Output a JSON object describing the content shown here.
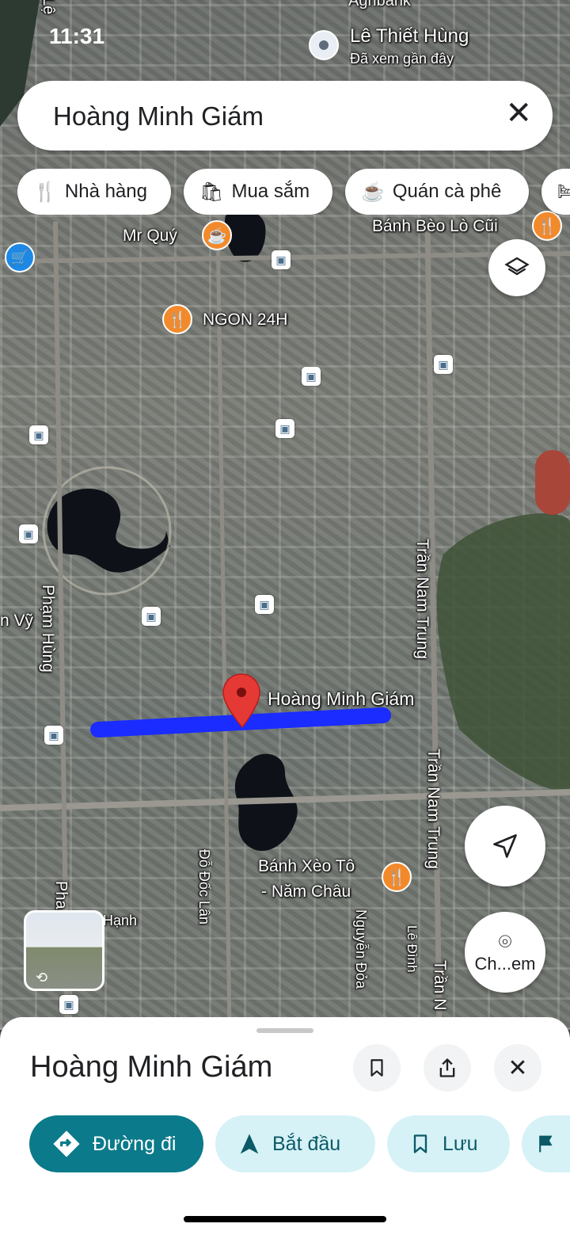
{
  "status_bar": {
    "time": "11:31"
  },
  "recent_place": {
    "name": "Lê Thiết Hùng",
    "subtitle": "Đã xem gần đây",
    "top_label": "Agribank"
  },
  "search": {
    "query": "Hoàng Minh Giám"
  },
  "chips": [
    {
      "label": "Nhà hàng",
      "icon": "fork-knife-icon"
    },
    {
      "label": "Mua sắm",
      "icon": "shopping-bag-icon"
    },
    {
      "label": "Quán cà phê",
      "icon": "coffee-cup-icon"
    }
  ],
  "map": {
    "pois": [
      {
        "name": "Mr Quý",
        "icon": "coffee-icon"
      },
      {
        "name": "Bánh Bèo Lò Cũi",
        "icon": "restaurant-icon"
      },
      {
        "name": "NGON 24H",
        "icon": "restaurant-icon"
      },
      {
        "name": "Bánh Xèo Tô - Năm Châu",
        "line1": "Bánh Xèo Tô",
        "line2": "- Năm Châu",
        "icon": "restaurant-icon"
      }
    ],
    "streets": {
      "pham_hung": "Phạm Hùng",
      "tran_nam_trung_1": "Trần Nam Trung",
      "tran_nam_trung_2": "Trần Nam Trung",
      "tran_n": "Trần N",
      "do_doc_lan": "Đỗ Đốc Lân",
      "nguyen_doa": "Nguyễn Đỏa",
      "le_dinh": "Lê Đình",
      "hanh": "Hạnh",
      "vy": "n Vỹ",
      "le_top": "Lệ",
      "ph": "Pha"
    },
    "selected_street": "Hoàng Minh Giám",
    "route_color": "#1a2cff",
    "pin_color": "#e53935"
  },
  "camera_button": {
    "label": "Ch...em"
  },
  "sheet": {
    "title": "Hoàng Minh Giám",
    "actions": [
      {
        "label": "Đường đi",
        "icon": "directions-icon"
      },
      {
        "label": "Bắt đầu",
        "icon": "navigation-arrow-icon"
      },
      {
        "label": "Lưu",
        "icon": "bookmark-icon"
      }
    ]
  },
  "colors": {
    "poi_orange": "#f28a2c",
    "primary": "#0b7a8a",
    "secondary_bg": "#d6f2f7"
  }
}
